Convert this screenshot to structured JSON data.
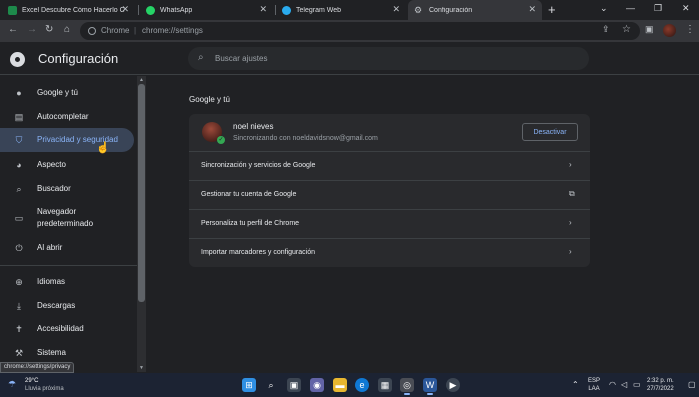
{
  "tabs": [
    {
      "title": "Excel Descubre Cómo Hacerlo C",
      "icon": "excel-icon",
      "color": "#1d8a4b"
    },
    {
      "title": "WhatsApp",
      "icon": "whatsapp-icon",
      "color": "#25d366"
    },
    {
      "title": "Telegram Web",
      "icon": "telegram-icon",
      "color": "#2aabee"
    },
    {
      "title": "Configuración",
      "icon": "gear-icon",
      "color": "#bdc1c6"
    }
  ],
  "omnibox": {
    "site_label": "Chrome",
    "url": "chrome://settings"
  },
  "header": {
    "title": "Configuración",
    "search_placeholder": "Buscar ajustes"
  },
  "sidebar": {
    "items": [
      {
        "label": "Google y tú",
        "icon": "person-icon"
      },
      {
        "label": "Autocompletar",
        "icon": "clipboard-icon"
      },
      {
        "label": "Privacidad y seguridad",
        "icon": "shield-icon"
      },
      {
        "label": "Aspecto",
        "icon": "palette-icon"
      },
      {
        "label": "Buscador",
        "icon": "search-icon"
      },
      {
        "label": "Navegador predeterminado",
        "icon": "browser-icon"
      },
      {
        "label": "Al abrir",
        "icon": "power-icon"
      },
      {
        "label": "Idiomas",
        "icon": "globe-icon"
      },
      {
        "label": "Descargas",
        "icon": "download-icon"
      },
      {
        "label": "Accesibilidad",
        "icon": "accessibility-icon"
      },
      {
        "label": "Sistema",
        "icon": "wrench-icon"
      }
    ]
  },
  "main": {
    "section_title": "Google y tú",
    "profile": {
      "name": "noel nieves",
      "status": "Sincronizando con noeldavidsnow@gmail.com",
      "button": "Desactivar"
    },
    "rows": [
      {
        "label": "Sincronización y servicios de Google",
        "icon": "chevron-right-icon"
      },
      {
        "label": "Gestionar tu cuenta de Google",
        "icon": "external-link-icon"
      },
      {
        "label": "Personaliza tu perfil de Chrome",
        "icon": "chevron-right-icon"
      },
      {
        "label": "Importar marcadores y configuración",
        "icon": "chevron-right-icon"
      }
    ]
  },
  "status_url": "chrome://settings/privacy",
  "taskbar": {
    "weather_temp": "29°C",
    "weather_desc": "Lluvia próxima",
    "lang_top": "ESP",
    "lang_bottom": "LAA",
    "time": "2:32 p. m.",
    "date": "27/7/2022"
  },
  "colors": {
    "accent": "#8ab4f8",
    "background": "#202124",
    "card": "#292a2d",
    "selected": "#394457"
  }
}
